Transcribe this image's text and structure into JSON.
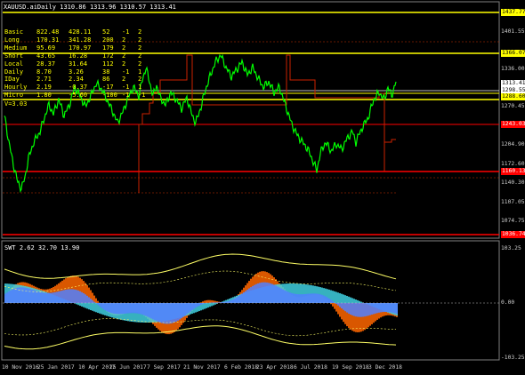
{
  "symbol_header": "XAUUSD.aiDaily",
  "ohlc": "1310.86 1313.96 1310.57 1313.41",
  "stats_table": [
    {
      "name": "Basic",
      "a": "822.48",
      "b": "428.11",
      "c": "52",
      "d": "-1",
      "e": "2"
    },
    {
      "name": "Long",
      "a": "170.31",
      "b": "341.28",
      "c": "200",
      "d": "2",
      "e": "2"
    },
    {
      "name": "Medium",
      "a": "95.69",
      "b": "170.97",
      "c": "179",
      "d": "2",
      "e": "2"
    },
    {
      "name": "Short",
      "a": "43.65",
      "b": "16.28",
      "c": "172",
      "d": "2",
      "e": "2"
    },
    {
      "name": "Local",
      "a": "28.37",
      "b": "31.64",
      "c": "112",
      "d": "2",
      "e": "2"
    },
    {
      "name": "Daily",
      "a": "8.70",
      "b": "3.26",
      "c": "38",
      "d": "-1",
      "e": "1"
    },
    {
      "name": "IDay",
      "a": "2.71",
      "b": "2.34",
      "c": "86",
      "d": "2",
      "e": "2"
    },
    {
      "name": "Hourly",
      "a": "2.19",
      "b": "-0.37",
      "c": "-17",
      "d": "-1",
      "e": "1"
    },
    {
      "name": "Micro",
      "a": "1.80",
      "b": "-5.60",
      "c": "-100",
      "d": "-1",
      "e": "-1"
    }
  ],
  "v_label": "V=3.03",
  "price_scale": [
    "1401.55",
    "1336.00",
    "1270.45",
    "1204.90",
    "1172.60",
    "1140.30",
    "1107.05",
    "1074.75"
  ],
  "level_tags": [
    {
      "text": "1437.77",
      "color": "#ffff00",
      "fg": "#000"
    },
    {
      "text": "1366.07",
      "color": "#ffff00",
      "fg": "#000"
    },
    {
      "text": "1313.41",
      "color": "#ffffff",
      "fg": "#000"
    },
    {
      "text": "1298.55",
      "color": "#ffffff",
      "fg": "#000"
    },
    {
      "text": "1288.60",
      "color": "#ffff00",
      "fg": "#000"
    },
    {
      "text": "1243.03",
      "color": "#ff0000",
      "fg": "#fff"
    },
    {
      "text": "1160.13",
      "color": "#ff0000",
      "fg": "#fff"
    },
    {
      "text": "1036.74",
      "color": "#ff0000",
      "fg": "#fff"
    }
  ],
  "indicator_label": "SWT 2.62 32.70 13.90",
  "indicator_scale": [
    "103.25",
    "0.00",
    "-103.25"
  ],
  "date_labels": [
    "10 Nov 2016",
    "25 Jan 2017",
    "10 Apr 2017",
    "25 Jun 2017",
    "7 Sep 2017",
    "21 Nov 2017",
    "6 Feb 2018",
    "23 Apr 2018",
    "6 Jul 2018",
    "19 Sep 2018",
    "3 Dec 2018"
  ],
  "colors": {
    "price_line": "#00ff00",
    "support": "#ff0000",
    "resistance": "#ffff00",
    "hist_orange": "#ff6600",
    "hist_cyan": "#40d0e0",
    "hist_blue": "#5080ff"
  }
}
